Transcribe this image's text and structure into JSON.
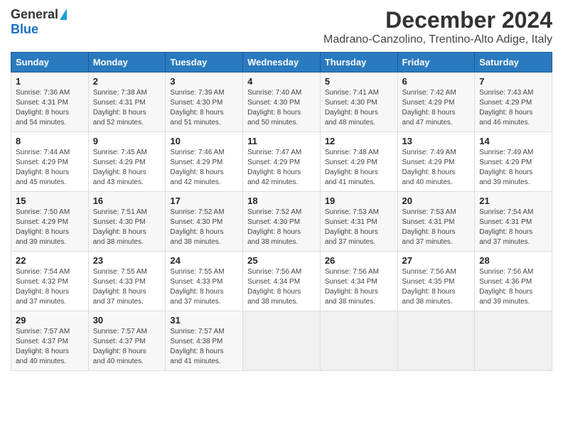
{
  "logo": {
    "general": "General",
    "blue": "Blue"
  },
  "title": "December 2024",
  "subtitle": "Madrano-Canzolino, Trentino-Alto Adige, Italy",
  "days_of_week": [
    "Sunday",
    "Monday",
    "Tuesday",
    "Wednesday",
    "Thursday",
    "Friday",
    "Saturday"
  ],
  "weeks": [
    [
      {
        "day": "1",
        "sunrise": "7:36 AM",
        "sunset": "4:31 PM",
        "daylight": "8 hours and 54 minutes."
      },
      {
        "day": "2",
        "sunrise": "7:38 AM",
        "sunset": "4:31 PM",
        "daylight": "8 hours and 52 minutes."
      },
      {
        "day": "3",
        "sunrise": "7:39 AM",
        "sunset": "4:30 PM",
        "daylight": "8 hours and 51 minutes."
      },
      {
        "day": "4",
        "sunrise": "7:40 AM",
        "sunset": "4:30 PM",
        "daylight": "8 hours and 50 minutes."
      },
      {
        "day": "5",
        "sunrise": "7:41 AM",
        "sunset": "4:30 PM",
        "daylight": "8 hours and 48 minutes."
      },
      {
        "day": "6",
        "sunrise": "7:42 AM",
        "sunset": "4:29 PM",
        "daylight": "8 hours and 47 minutes."
      },
      {
        "day": "7",
        "sunrise": "7:43 AM",
        "sunset": "4:29 PM",
        "daylight": "8 hours and 46 minutes."
      }
    ],
    [
      {
        "day": "8",
        "sunrise": "7:44 AM",
        "sunset": "4:29 PM",
        "daylight": "8 hours and 45 minutes."
      },
      {
        "day": "9",
        "sunrise": "7:45 AM",
        "sunset": "4:29 PM",
        "daylight": "8 hours and 43 minutes."
      },
      {
        "day": "10",
        "sunrise": "7:46 AM",
        "sunset": "4:29 PM",
        "daylight": "8 hours and 42 minutes."
      },
      {
        "day": "11",
        "sunrise": "7:47 AM",
        "sunset": "4:29 PM",
        "daylight": "8 hours and 42 minutes."
      },
      {
        "day": "12",
        "sunrise": "7:48 AM",
        "sunset": "4:29 PM",
        "daylight": "8 hours and 41 minutes."
      },
      {
        "day": "13",
        "sunrise": "7:49 AM",
        "sunset": "4:29 PM",
        "daylight": "8 hours and 40 minutes."
      },
      {
        "day": "14",
        "sunrise": "7:49 AM",
        "sunset": "4:29 PM",
        "daylight": "8 hours and 39 minutes."
      }
    ],
    [
      {
        "day": "15",
        "sunrise": "7:50 AM",
        "sunset": "4:29 PM",
        "daylight": "8 hours and 39 minutes."
      },
      {
        "day": "16",
        "sunrise": "7:51 AM",
        "sunset": "4:30 PM",
        "daylight": "8 hours and 38 minutes."
      },
      {
        "day": "17",
        "sunrise": "7:52 AM",
        "sunset": "4:30 PM",
        "daylight": "8 hours and 38 minutes."
      },
      {
        "day": "18",
        "sunrise": "7:52 AM",
        "sunset": "4:30 PM",
        "daylight": "8 hours and 38 minutes."
      },
      {
        "day": "19",
        "sunrise": "7:53 AM",
        "sunset": "4:31 PM",
        "daylight": "8 hours and 37 minutes."
      },
      {
        "day": "20",
        "sunrise": "7:53 AM",
        "sunset": "4:31 PM",
        "daylight": "8 hours and 37 minutes."
      },
      {
        "day": "21",
        "sunrise": "7:54 AM",
        "sunset": "4:31 PM",
        "daylight": "8 hours and 37 minutes."
      }
    ],
    [
      {
        "day": "22",
        "sunrise": "7:54 AM",
        "sunset": "4:32 PM",
        "daylight": "8 hours and 37 minutes."
      },
      {
        "day": "23",
        "sunrise": "7:55 AM",
        "sunset": "4:33 PM",
        "daylight": "8 hours and 37 minutes."
      },
      {
        "day": "24",
        "sunrise": "7:55 AM",
        "sunset": "4:33 PM",
        "daylight": "8 hours and 37 minutes."
      },
      {
        "day": "25",
        "sunrise": "7:56 AM",
        "sunset": "4:34 PM",
        "daylight": "8 hours and 38 minutes."
      },
      {
        "day": "26",
        "sunrise": "7:56 AM",
        "sunset": "4:34 PM",
        "daylight": "8 hours and 38 minutes."
      },
      {
        "day": "27",
        "sunrise": "7:56 AM",
        "sunset": "4:35 PM",
        "daylight": "8 hours and 38 minutes."
      },
      {
        "day": "28",
        "sunrise": "7:56 AM",
        "sunset": "4:36 PM",
        "daylight": "8 hours and 39 minutes."
      }
    ],
    [
      {
        "day": "29",
        "sunrise": "7:57 AM",
        "sunset": "4:37 PM",
        "daylight": "8 hours and 40 minutes."
      },
      {
        "day": "30",
        "sunrise": "7:57 AM",
        "sunset": "4:37 PM",
        "daylight": "8 hours and 40 minutes."
      },
      {
        "day": "31",
        "sunrise": "7:57 AM",
        "sunset": "4:38 PM",
        "daylight": "8 hours and 41 minutes."
      },
      null,
      null,
      null,
      null
    ]
  ]
}
